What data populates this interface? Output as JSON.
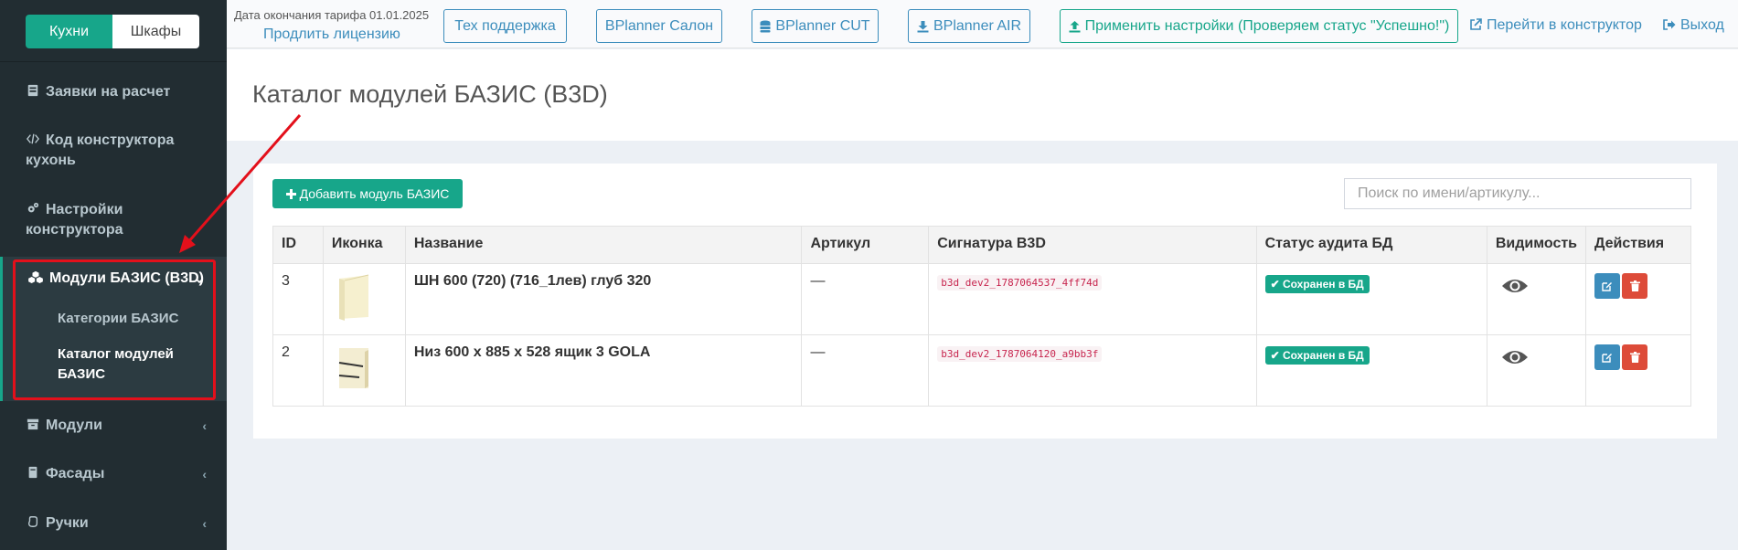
{
  "sidebar": {
    "switch": {
      "kitchens": "Кухни",
      "wardrobes": "Шкафы"
    },
    "items": {
      "requests": "Заявки на расчет",
      "code": "Код конструктора кухонь",
      "settings": "Настройки конструктора",
      "bazis_modules": "Модули БАЗИС (B3D)",
      "bazis_categories": "Категории БАЗИС",
      "bazis_catalog": "Каталог модулей БАЗИС",
      "modules": "Модули",
      "facades": "Фасады",
      "handles": "Ручки"
    }
  },
  "topbar": {
    "tariff": "Дата окончания тарифа 01.01.2025",
    "renew": "Продлить лицензию",
    "support": "Тех поддержка",
    "salon": "BPlanner Салон",
    "cut": "BPlanner CUT",
    "air": "BPlanner AIR",
    "apply": "Применить настройки (Проверяем статус \"Успешно!\")",
    "constructor": "Перейти в конструктор",
    "logout": "Выход"
  },
  "page": {
    "title": "Каталог модулей БАЗИС (B3D)",
    "add_button": "Добавить модуль БАЗИС",
    "search_placeholder": "Поиск по имени/артикулу..."
  },
  "table": {
    "headers": [
      "ID",
      "Иконка",
      "Название",
      "Артикул",
      "Сигнатура B3D",
      "Статус аудита БД",
      "Видимость",
      "Действия"
    ],
    "rows": [
      {
        "id": "3",
        "name": "ШН 600 (720) (716_1лев) глуб 320",
        "article": "—",
        "signature": "b3d_dev2_1787064537_4ff74d",
        "status": "Сохранен в БД"
      },
      {
        "id": "2",
        "name": "Низ 600 х 885 х 528 ящик 3 GOLA",
        "article": "—",
        "signature": "b3d_dev2_1787064120_a9bb3f",
        "status": "Сохранен в БД"
      }
    ]
  },
  "colors": {
    "sidebar": "#222d32",
    "accent": "#17a68a",
    "link": "#3c8dbc",
    "danger": "#dd4b39",
    "annotation": "#e3101b"
  },
  "icons": [
    "inbox-icon",
    "code-icon",
    "cogs-icon",
    "cubes-icon",
    "archive-icon",
    "book-icon",
    "hand-icon",
    "database-icon",
    "download-icon",
    "upload-icon",
    "external-link-icon",
    "sign-out-icon",
    "plus-icon",
    "eye-icon",
    "edit-icon",
    "trash-icon",
    "check-icon"
  ]
}
